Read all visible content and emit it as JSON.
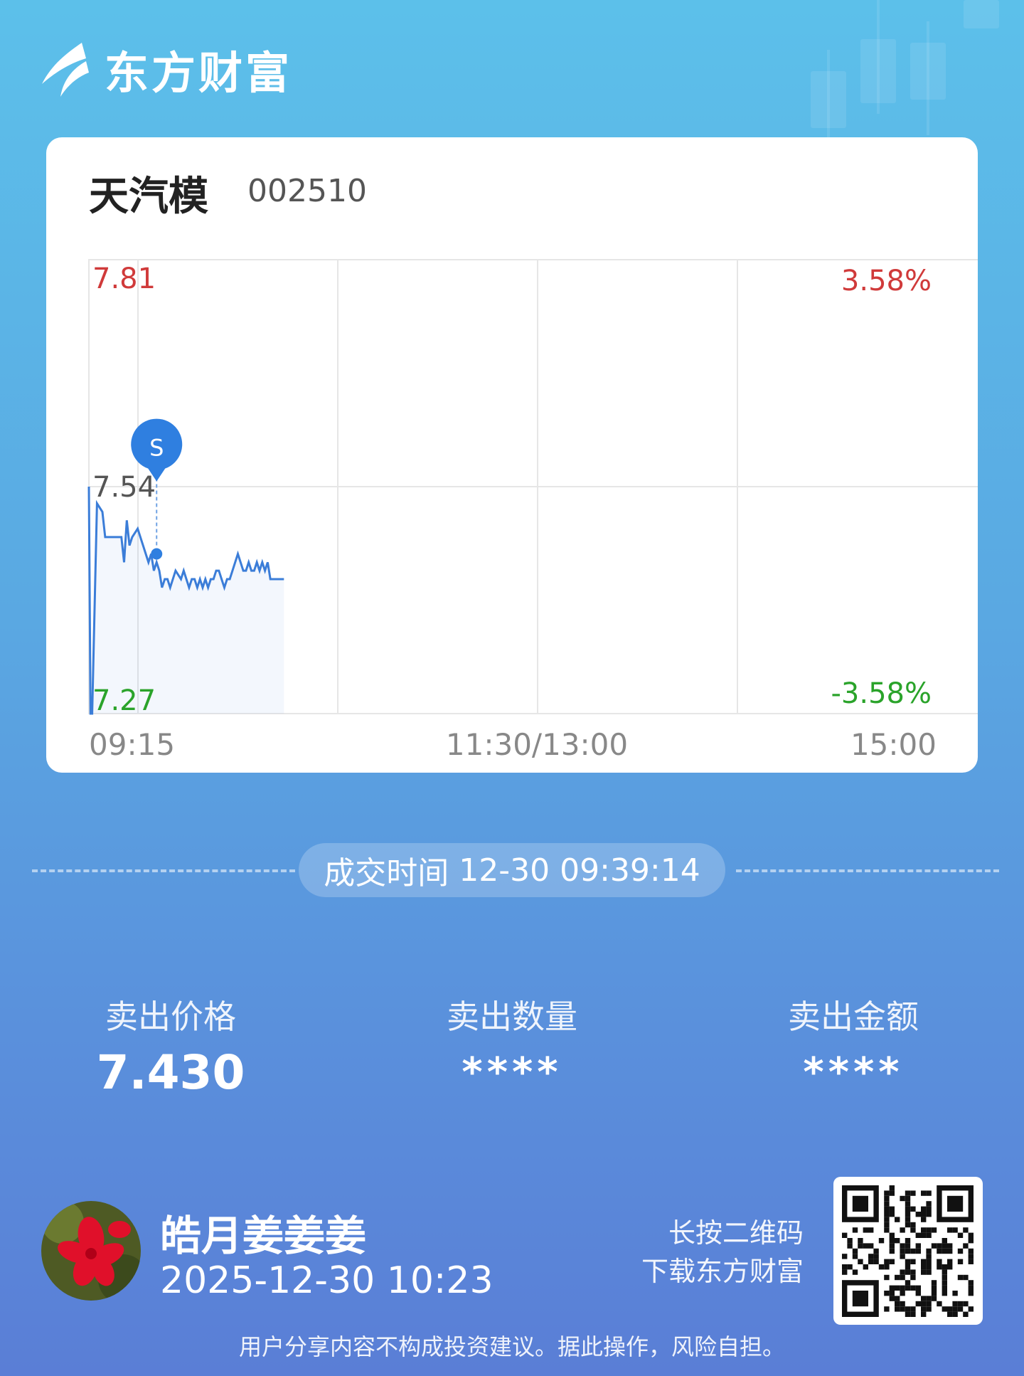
{
  "header": {
    "brand": "东方财富"
  },
  "stock": {
    "name": "天汽模",
    "code": "002510"
  },
  "chart_data": {
    "type": "line",
    "y_left_labels": {
      "top": "7.81",
      "mid": "7.54",
      "bottom": "7.27"
    },
    "y_right_labels": {
      "top": "3.58%",
      "bottom": "-3.58%"
    },
    "x_labels": {
      "start": "09:15",
      "mid": "11:30/13:00",
      "end": "15:00"
    },
    "ylim": [
      7.27,
      7.81
    ],
    "xlim_minutes": [
      0,
      330
    ],
    "series": [
      {
        "x": [
          0,
          0.6,
          1.2,
          3,
          5,
          6,
          7,
          8,
          9,
          10,
          11,
          12,
          13,
          14,
          15,
          16,
          18,
          20,
          21,
          22,
          23,
          24,
          25,
          26,
          27,
          28,
          29,
          30,
          32,
          34,
          35,
          36,
          37,
          38,
          39,
          40,
          41,
          42,
          43,
          44,
          45,
          46,
          47,
          48,
          49,
          50,
          51,
          52,
          54,
          55,
          56,
          57,
          58,
          59,
          60,
          61,
          62,
          63,
          64,
          65,
          66,
          67,
          68,
          69,
          70,
          71,
          72
        ],
        "y": [
          7.54,
          7.27,
          7.27,
          7.52,
          7.51,
          7.48,
          7.48,
          7.48,
          7.48,
          7.48,
          7.48,
          7.48,
          7.45,
          7.5,
          7.47,
          7.48,
          7.49,
          7.47,
          7.46,
          7.45,
          7.46,
          7.44,
          7.45,
          7.44,
          7.42,
          7.43,
          7.43,
          7.42,
          7.44,
          7.43,
          7.44,
          7.43,
          7.42,
          7.43,
          7.43,
          7.42,
          7.43,
          7.42,
          7.43,
          7.42,
          7.43,
          7.43,
          7.44,
          7.44,
          7.43,
          7.42,
          7.43,
          7.43,
          7.45,
          7.46,
          7.45,
          7.44,
          7.44,
          7.45,
          7.44,
          7.44,
          7.45,
          7.44,
          7.45,
          7.44,
          7.45,
          7.43,
          7.43,
          7.43,
          7.43,
          7.43,
          7.43
        ]
      }
    ],
    "trade_marker": {
      "label": "S",
      "x": 25,
      "y": 7.46
    }
  },
  "trade": {
    "time_label": "成交时间",
    "time_value": "12-30 09:39:14"
  },
  "stats": {
    "price_label": "卖出价格",
    "price_value": "7.430",
    "qty_label": "卖出数量",
    "qty_value": "****",
    "amount_label": "卖出金额",
    "amount_value": "****"
  },
  "user": {
    "name": "皓月姜姜姜",
    "datetime": "2025-12-30 10:23"
  },
  "qr": {
    "hint_line1": "长按二维码",
    "hint_line2": "下载东方财富"
  },
  "footer": {
    "disclaimer": "用户分享内容不构成投资建议。据此操作，风险自担。"
  },
  "colors": {
    "up": "#d03a3a",
    "down": "#2aa32a",
    "line": "#3b7dd8",
    "marker": "#2f7fe0"
  }
}
